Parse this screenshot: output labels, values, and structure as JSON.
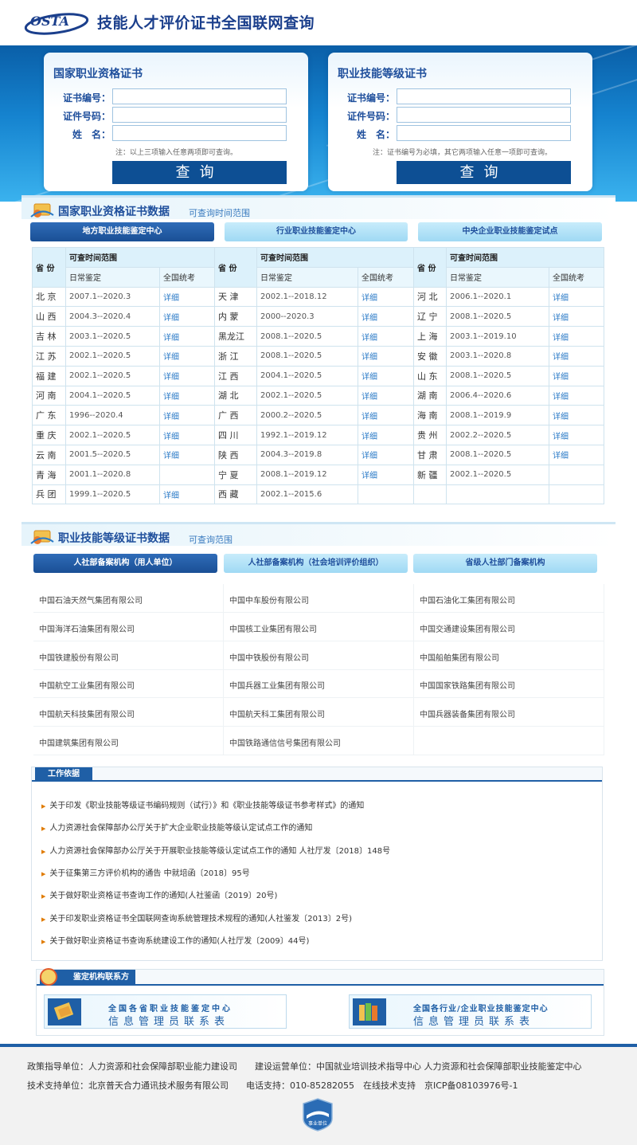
{
  "header": {
    "logo_text": "OSTA",
    "site_title": "技能人才评价证书全国联网查询"
  },
  "query_left": {
    "title": "国家职业资格证书",
    "fields": [
      {
        "label": "证书编号："
      },
      {
        "label": "证件号码："
      },
      {
        "label": "姓　名："
      }
    ],
    "note": "注：以上三项输入任意两项即可查询。",
    "button": "查询"
  },
  "query_right": {
    "title": "职业技能等级证书",
    "fields": [
      {
        "label": "证书编号："
      },
      {
        "label": "证件号码："
      },
      {
        "label": "姓　名："
      }
    ],
    "note": "注：证书编号为必填，其它两项输入任意一项即可查询。",
    "button": "查询"
  },
  "section1": {
    "title": "国家职业资格证书数据",
    "subtitle": "可查询时间范围",
    "tabs": [
      "地方职业技能鉴定中心",
      "行业职业技能鉴定中心",
      "中央企业职业技能鉴定试点"
    ],
    "th_province": "省 份",
    "th_range": "可查时间范围",
    "th_daily": "日常鉴定",
    "th_unified": "全国统考",
    "rows": [
      [
        [
          "北 京",
          "2007.1--2020.3",
          "详细"
        ],
        [
          "天 津",
          "2002.1--2018.12",
          "详细"
        ],
        [
          "河 北",
          "2006.1--2020.1",
          "详细"
        ]
      ],
      [
        [
          "山 西",
          "2004.3--2020.4",
          "详细"
        ],
        [
          "内 蒙",
          "2000--2020.3",
          "详细"
        ],
        [
          "辽 宁",
          "2008.1--2020.5",
          "详细"
        ]
      ],
      [
        [
          "吉 林",
          "2003.1--2020.5",
          "详细"
        ],
        [
          "黑龙江",
          "2008.1--2020.5",
          "详细"
        ],
        [
          "上 海",
          "2003.1--2019.10",
          "详细"
        ]
      ],
      [
        [
          "江 苏",
          "2002.1--2020.5",
          "详细"
        ],
        [
          "浙 江",
          "2008.1--2020.5",
          "详细"
        ],
        [
          "安 徽",
          "2003.1--2020.8",
          "详细"
        ]
      ],
      [
        [
          "福 建",
          "2002.1--2020.5",
          "详细"
        ],
        [
          "江 西",
          "2004.1--2020.5",
          "详细"
        ],
        [
          "山 东",
          "2008.1--2020.5",
          "详细"
        ]
      ],
      [
        [
          "河 南",
          "2004.1--2020.5",
          "详细"
        ],
        [
          "湖 北",
          "2002.1--2020.5",
          "详细"
        ],
        [
          "湖 南",
          "2006.4--2020.6",
          "详细"
        ]
      ],
      [
        [
          "广 东",
          "1996--2020.4",
          "详细"
        ],
        [
          "广 西",
          "2000.2--2020.5",
          "详细"
        ],
        [
          "海 南",
          "2008.1--2019.9",
          "详细"
        ]
      ],
      [
        [
          "重 庆",
          "2002.1--2020.5",
          "详细"
        ],
        [
          "四 川",
          "1992.1--2019.12",
          "详细"
        ],
        [
          "贵 州",
          "2002.2--2020.5",
          "详细"
        ]
      ],
      [
        [
          "云 南",
          "2001.5--2020.5",
          "详细"
        ],
        [
          "陕 西",
          "2004.3--2019.8",
          "详细"
        ],
        [
          "甘 肃",
          "2008.1--2020.5",
          "详细"
        ]
      ],
      [
        [
          "青 海",
          "2001.1--2020.8",
          ""
        ],
        [
          "宁 夏",
          "2008.1--2019.12",
          "详细"
        ],
        [
          "新 疆",
          "2002.1--2020.5",
          ""
        ]
      ],
      [
        [
          "兵 团",
          "1999.1--2020.5",
          "详细"
        ],
        [
          "西 藏",
          "2002.1--2015.6",
          ""
        ],
        [
          "",
          "",
          ""
        ]
      ]
    ]
  },
  "section2": {
    "title": "职业技能等级证书数据",
    "subtitle": "可查询范围",
    "tabs": [
      "人社部备案机构（用人单位）",
      "人社部备案机构（社会培训评价组织）",
      "省级人社部门备案机构"
    ],
    "orgs": [
      "中国石油天然气集团有限公司",
      "中国中车股份有限公司",
      "中国石油化工集团有限公司",
      "中国海洋石油集团有限公司",
      "中国核工业集团有限公司",
      "中国交通建设集团有限公司",
      "中国铁建股份有限公司",
      "中国中铁股份有限公司",
      "中国船舶集团有限公司",
      "中国航空工业集团有限公司",
      "中国兵器工业集团有限公司",
      "中国国家铁路集团有限公司",
      "中国航天科技集团有限公司",
      "中国航天科工集团有限公司",
      "中国兵器装备集团有限公司",
      "中国建筑集团有限公司",
      "中国铁路通信信号集团有限公司",
      ""
    ]
  },
  "basis": {
    "tag": "工作依据",
    "links": [
      "关于印发《职业技能等级证书编码规则（试行）》和《职业技能等级证书参考样式》的通知",
      "人力资源社会保障部办公厅关于扩大企业职业技能等级认定试点工作的通知",
      "人力资源社会保障部办公厅关于开展职业技能等级认定试点工作的通知 人社厅发〔2018〕148号",
      "关于征集第三方评价机构的通告 中就培函〔2018〕95号",
      "关于做好职业资格证书查询工作的通知(人社鉴函〔2019〕20号)",
      "关于印发职业资格证书全国联网查询系统管理技术规程的通知(人社鉴发〔2013〕2号)",
      "关于做好职业资格证书查询系统建设工作的通知(人社厅发〔2009〕44号)"
    ]
  },
  "contact": {
    "tag": "鉴定机构联系方式",
    "left": {
      "line1": "全国各省职业技能鉴定中心",
      "line2": "信息管理员联系表"
    },
    "right": {
      "line1": "全国各行业/企业职业技能鉴定中心",
      "line2": "信息管理员联系表"
    }
  },
  "footer": {
    "line1": "政策指导单位：人力资源和社会保障部职业能力建设司　　建设运营单位：中国就业培训技术指导中心  人力资源和社会保障部职业技能鉴定中心",
    "line2": "技术支持单位：北京普天合力通讯技术服务有限公司　　电话支持：010-85282055　在线技术支持　京ICP备08103976号-1",
    "seal_text": "事业单位"
  },
  "colors": {
    "primary": "#1f4f9c",
    "accent": "#1583cf",
    "link": "#2a7ac7"
  }
}
